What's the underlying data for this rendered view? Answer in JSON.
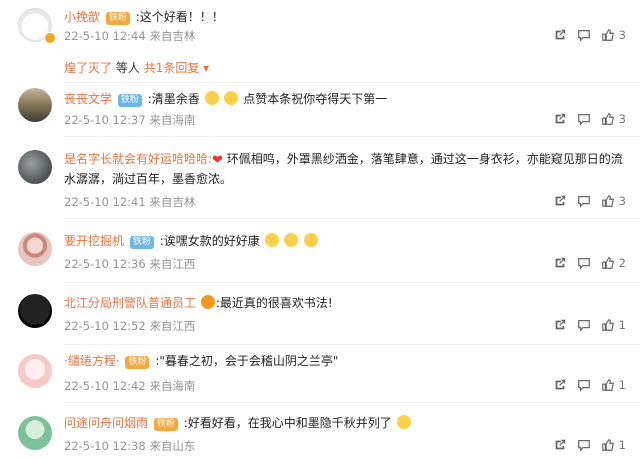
{
  "comments": [
    {
      "name": "小挽歆",
      "medal": "铁粉",
      "text": ":这个好看！！！",
      "time": "22-5-10 12:44",
      "loc": "来自吉林",
      "likes": "3",
      "reply_summary": {
        "names": "煌了灭了",
        "middle": "等人",
        "more": "共1条回复"
      }
    },
    {
      "name": "丧丧文学",
      "medal": "铁粉",
      "text": ":清墨余香",
      "text2": "点赞本条祝你夺得天下第一",
      "time": "22-5-10 12:37",
      "loc": "来自海南",
      "likes": "3"
    },
    {
      "name": "是名字长就会有好运哈哈哈:",
      "text": " 环佩相鸣，外罩黑纱洒金，落笔肆意，通过这一身衣衫，亦能窥见那日的流水潺潺，淌过百年，墨香愈浓。",
      "time": "22-5-10 12:41",
      "loc": "来自吉林",
      "likes": "3"
    },
    {
      "name": "要开挖掘机",
      "medal": "铁粉",
      "text": ":诶嘿女款的好好康",
      "time": "22-5-10 12:36",
      "loc": "来自江西",
      "likes": "2"
    },
    {
      "name": "北江分局刑警队普通员工",
      "text": ":最近真的很喜欢书法!",
      "time": "22-5-10 12:52",
      "loc": "来自江西",
      "likes": "1"
    },
    {
      "name": "·缱绻方程·",
      "medal": "铁粉",
      "text": ":\"暮春之初，会于会稽山阴之兰亭\"",
      "time": "22-5-10 12:42",
      "loc": "来自海南",
      "likes": "1"
    },
    {
      "name": "问途问舟问烟雨",
      "medal": "铁粉",
      "text": ":好看好看，在我心中和墨隐千秋并列了",
      "time": "22-5-10 12:38",
      "loc": "来自山东",
      "likes": "1"
    }
  ]
}
